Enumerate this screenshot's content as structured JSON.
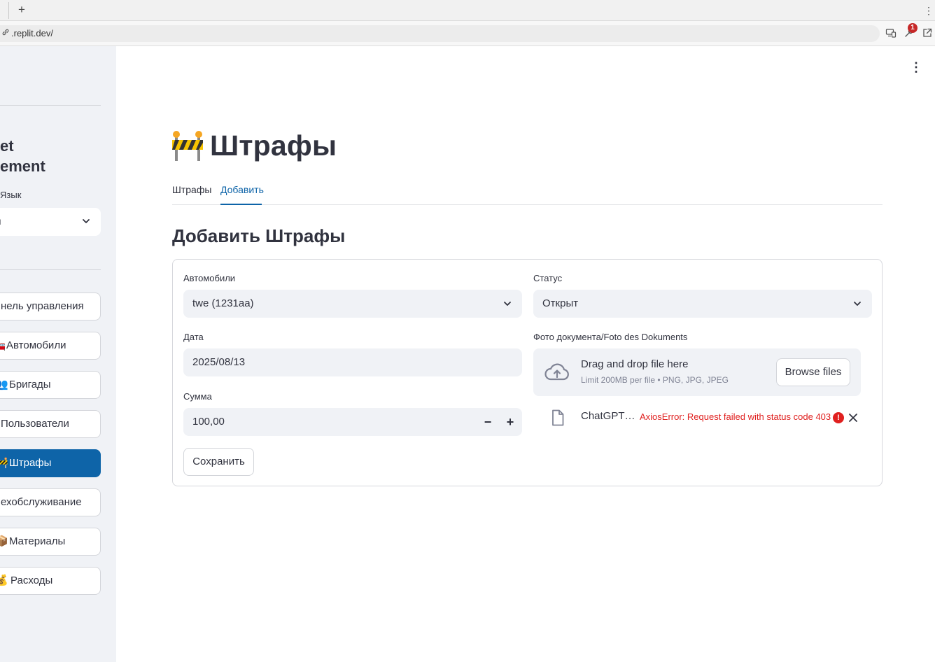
{
  "browser": {
    "new_tab": "+",
    "menu": "⋮",
    "url": ".replit.dev/",
    "notification_count": "1"
  },
  "sidebar": {
    "brand_line1": "et",
    "brand_line2": "ement",
    "language_label": "Язык",
    "language_value": "ı",
    "nav": [
      {
        "label": "нель управления",
        "icon": ""
      },
      {
        "label": "Автомобили",
        "icon": "🚗"
      },
      {
        "label": "Бригады",
        "icon": "👥"
      },
      {
        "label": "Пользователи",
        "icon": ""
      },
      {
        "label": "Штрафы",
        "icon": "🚧"
      },
      {
        "label": "ехобслуживание",
        "icon": ""
      },
      {
        "label": "Материалы",
        "icon": "📦"
      },
      {
        "label": "Расходы",
        "icon": "💰"
      }
    ],
    "active_index": 4
  },
  "main": {
    "menu": "⋮",
    "title": "Штрафы",
    "tabs": [
      {
        "label": "Штрафы"
      },
      {
        "label": "Добавить"
      }
    ],
    "active_tab": 1,
    "section_title": "Добавить Штрафы",
    "form": {
      "cars_label": "Автомобили",
      "cars_value": "twe (1231aa)",
      "status_label": "Статус",
      "status_value": "Открыт",
      "date_label": "Дата",
      "date_value": "2025/08/13",
      "photo_label": "Фото документа/Foto des Dokuments",
      "dropzone_title": "Drag and drop file here",
      "dropzone_sub": "Limit 200MB per file • PNG, JPG, JPEG",
      "browse_label": "Browse files",
      "amount_label": "Сумма",
      "amount_value": "100,00",
      "minus": "−",
      "plus": "+",
      "file_name": "ChatGPT…",
      "file_error": "AxiosError: Request failed with status code 403",
      "error_icon": "!",
      "save_label": "Сохранить"
    }
  },
  "colors": {
    "primary": "#0e64a8",
    "sidebar_bg": "#f0f2f6",
    "error": "#e0201f"
  }
}
